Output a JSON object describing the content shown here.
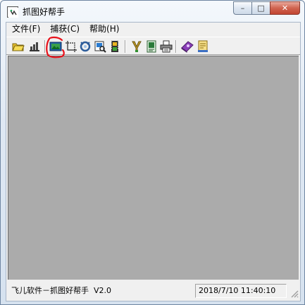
{
  "window": {
    "title": "抓图好帮手",
    "caption": {
      "minimize": "–",
      "maximize": "□",
      "close": "✕"
    }
  },
  "menu": [
    {
      "label": "文件(F)"
    },
    {
      "label": "捕获(C)"
    },
    {
      "label": "帮助(H)"
    }
  ],
  "toolbar": {
    "buttons": [
      {
        "icon": "open-folder-icon"
      },
      {
        "icon": "save-icon"
      },
      {
        "icon": "capture-screen-icon",
        "highlighted": true
      },
      {
        "icon": "capture-region-icon"
      },
      {
        "icon": "capture-window-icon"
      },
      {
        "icon": "capture-object-icon"
      },
      {
        "icon": "capture-scroll-icon"
      },
      {
        "icon": "paint-icon"
      },
      {
        "icon": "edit-icon"
      },
      {
        "icon": "print-icon"
      },
      {
        "icon": "help-book-icon"
      },
      {
        "icon": "about-icon"
      }
    ]
  },
  "status": {
    "app_name": "飞儿软件－抓图好帮手",
    "version": "V2.0",
    "datetime": "2018/7/10 11:40:10"
  },
  "colors": {
    "workspace": "#ababab",
    "annotation": "#e8101a"
  }
}
